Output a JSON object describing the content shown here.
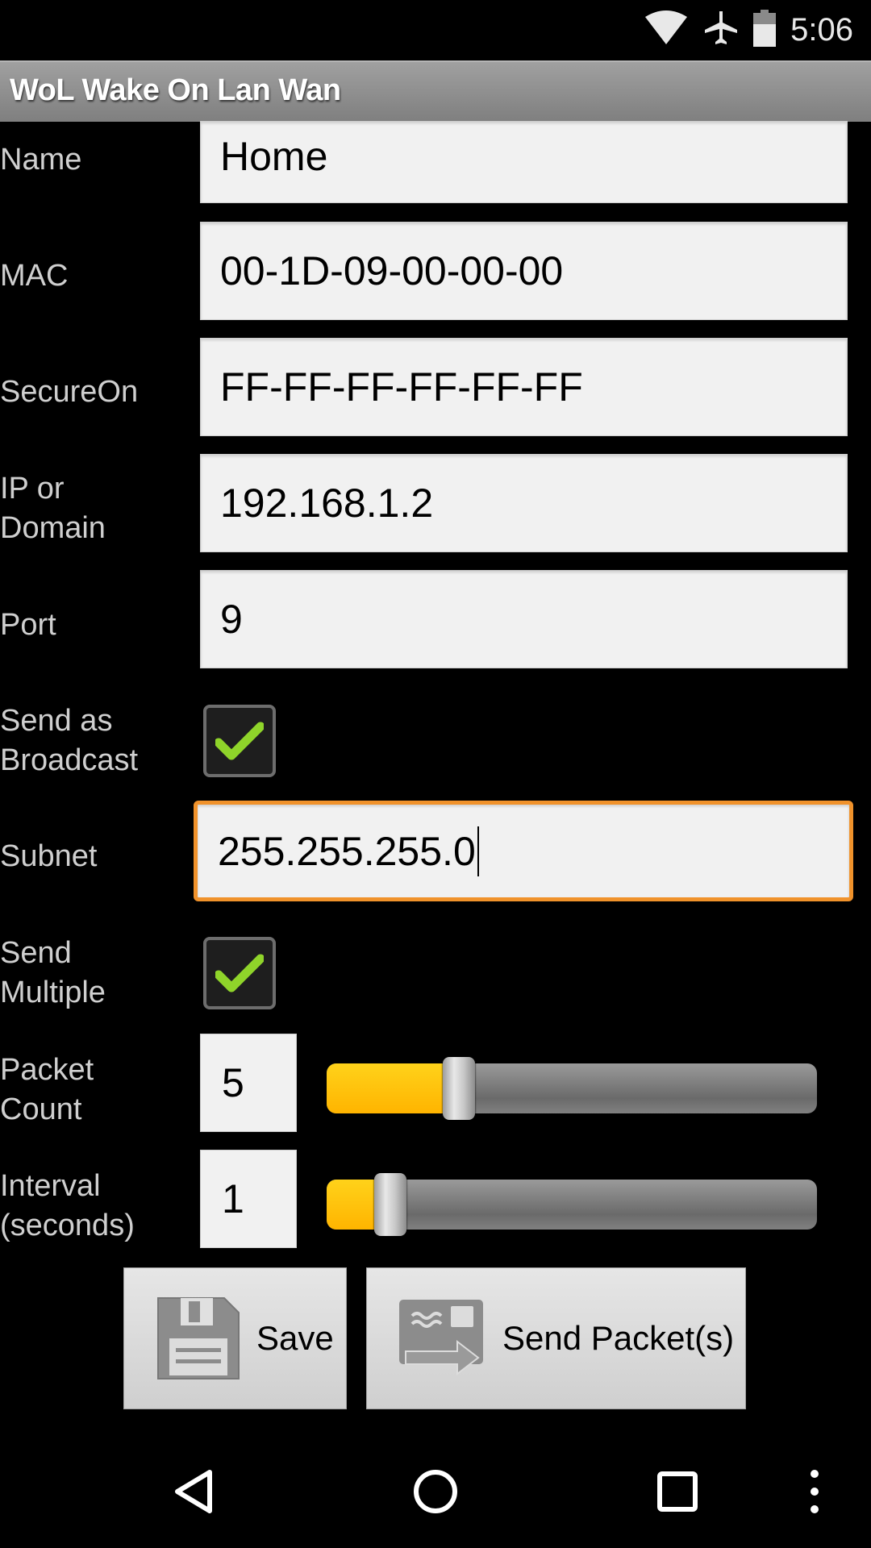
{
  "status_bar": {
    "time": "5:06",
    "icons": [
      "wifi-icon",
      "airplane-mode-icon",
      "battery-icon"
    ]
  },
  "app": {
    "title": "WoL Wake On Lan Wan"
  },
  "form": {
    "name": {
      "label": "Name",
      "value": "Home"
    },
    "mac": {
      "label": "MAC",
      "value": "00-1D-09-00-00-00"
    },
    "secureon": {
      "label": "SecureOn",
      "value": "FF-FF-FF-FF-FF-FF"
    },
    "ip": {
      "label_line1": "IP or",
      "label_line2": "Domain",
      "value": "192.168.1.2"
    },
    "port": {
      "label": "Port",
      "value": "9"
    },
    "broadcast": {
      "label_line1": "Send as",
      "label_line2": "Broadcast",
      "checked": true
    },
    "subnet": {
      "label": "Subnet",
      "value": "255.255.255.0",
      "focused": true
    },
    "multiple": {
      "label_line1": "Send",
      "label_line2": "Multiple",
      "checked": true
    },
    "packet_count": {
      "label_line1": "Packet",
      "label_line2": "Count",
      "value": "5",
      "slider_fraction": 0.27
    },
    "interval": {
      "label_line1": "Interval",
      "label_line2": "(seconds)",
      "value": "1",
      "slider_fraction": 0.13
    }
  },
  "buttons": {
    "save": {
      "label": "Save",
      "icon": "floppy-disk-icon"
    },
    "send": {
      "label": "Send Packet(s)",
      "icon": "send-packet-icon"
    }
  },
  "nav": {
    "back": "back-icon",
    "home": "home-icon",
    "recents": "recents-icon",
    "overflow": "overflow-menu-icon"
  },
  "colors": {
    "accent_focus": "#f0922b",
    "slider_fill": "#ffc107",
    "check": "#8fd42a"
  }
}
